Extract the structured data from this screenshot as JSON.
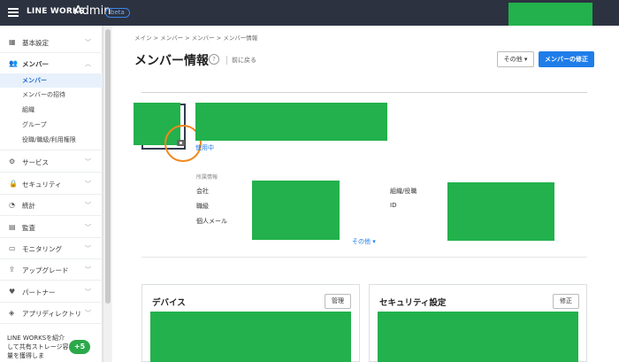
{
  "topbar": {
    "brand": "LINE WORKS",
    "admin": "Admin",
    "beta": "beta"
  },
  "sidebar": {
    "sections": [
      {
        "label": "基本設定",
        "icon": "building-icon"
      },
      {
        "label": "メンバー",
        "icon": "users-icon"
      },
      {
        "label": "サービス",
        "icon": "gear-icon"
      },
      {
        "label": "セキュリティ",
        "icon": "lock-icon"
      },
      {
        "label": "統計",
        "icon": "pie-chart-icon"
      },
      {
        "label": "監査",
        "icon": "audit-icon"
      },
      {
        "label": "モニタリング",
        "icon": "monitor-icon"
      },
      {
        "label": "アップグレード",
        "icon": "upgrade-icon"
      },
      {
        "label": "パートナー",
        "icon": "partner-icon"
      },
      {
        "label": "アプリディレクトリ",
        "icon": "layers-icon"
      }
    ],
    "member_items": [
      "メンバー",
      "メンバーの招待",
      "組織",
      "グループ",
      "役職/職級/利用権限"
    ],
    "promo_text": "LINE WORKSを紹介して共有ストレージ容量を獲得しま",
    "promo_badge": "+5"
  },
  "main": {
    "breadcrumb": "メイン  >  メンバー  >  メンバー  >  メンバー情報",
    "title": "メンバー情報",
    "help": "?",
    "back": "前に戻る",
    "other_button": "その他 ▾",
    "edit_button": "メンバーの修正",
    "status": "使用中",
    "affiliation_label": "所属情報",
    "fields": {
      "company": "会社",
      "rank": "職級",
      "personal_email": "個人メール",
      "org_role": "組織/役職",
      "id": "ID"
    },
    "more": "その他 ▾"
  },
  "cards": {
    "device": {
      "title": "デバイス",
      "button": "管理"
    },
    "security": {
      "title": "セキュリティ設定",
      "button": "修正"
    }
  },
  "colors": {
    "accent": "#1f7de9",
    "topbar": "#2c3240",
    "highlight": "#f2881f"
  }
}
